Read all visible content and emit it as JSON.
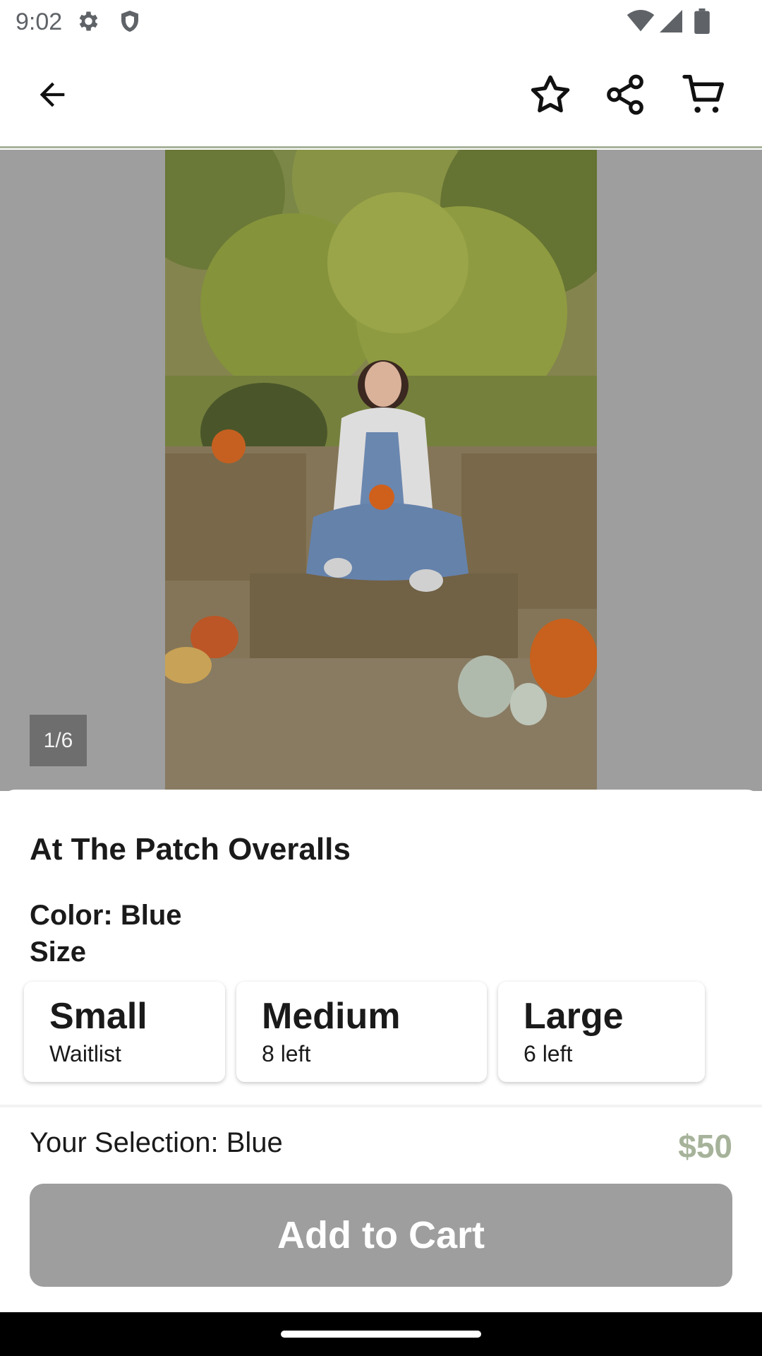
{
  "status_bar": {
    "time": "9:02"
  },
  "header": {
    "back_icon": "arrow-left-icon",
    "favorite_icon": "star-outline-icon",
    "share_icon": "share-icon",
    "cart_icon": "cart-icon"
  },
  "gallery": {
    "page_indicator": "1/6"
  },
  "product": {
    "title": "At The Patch Overalls",
    "color_label": "Color: Blue",
    "size_label": "Size",
    "sizes": [
      {
        "name": "Small",
        "stock": "Waitlist"
      },
      {
        "name": "Medium",
        "stock": "8 left"
      },
      {
        "name": "Large",
        "stock": "6 left"
      }
    ]
  },
  "footer": {
    "selection": "Your Selection: Blue",
    "price": "$50",
    "add_to_cart": "Add to Cart"
  },
  "colors": {
    "accent": "#a6b39a",
    "button_disabled": "#9e9e9e"
  }
}
